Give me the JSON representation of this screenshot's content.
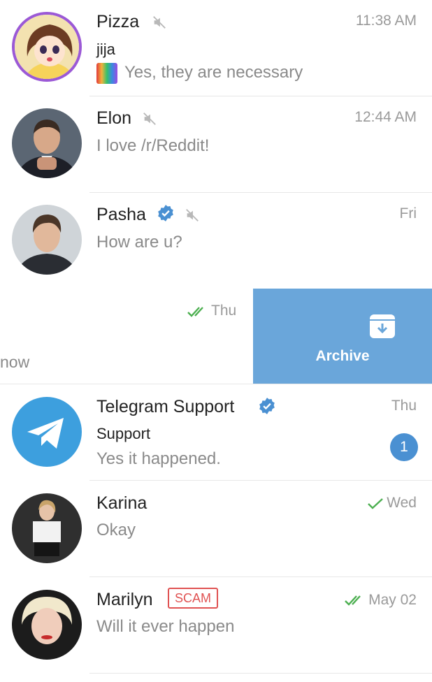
{
  "chats": [
    {
      "name": "Pizza",
      "sender": "jija",
      "message": "Yes, they are necessary",
      "time": "11:38 AM",
      "muted": true
    },
    {
      "name": "Elon",
      "message": "I love /r/Reddit!",
      "time": "12:44 AM",
      "muted": true
    },
    {
      "name": "Pasha",
      "message": "How are u?",
      "time": "Fri",
      "verified": true,
      "muted": true
    },
    {
      "partial_text": "now",
      "time": "Thu",
      "status": "read"
    },
    {
      "name": "Telegram Support",
      "sender": "Support",
      "message": "Yes it happened.",
      "time": "Thu",
      "verified": true,
      "unread": "1"
    },
    {
      "name": "Karina",
      "message": "Okay",
      "time": "Wed",
      "status": "sent"
    },
    {
      "name": "Marilyn",
      "label": "SCAM",
      "message": "Will it ever happen",
      "time": "May 02",
      "status": "read"
    }
  ],
  "swipe_action": {
    "label": "Archive",
    "icon": "archive-icon"
  },
  "colors": {
    "accent": "#4a90d2",
    "archive_bg": "#6aa6da",
    "read_check": "#4caf50",
    "scam": "#e05252",
    "muted_text": "#8a8a8a"
  }
}
